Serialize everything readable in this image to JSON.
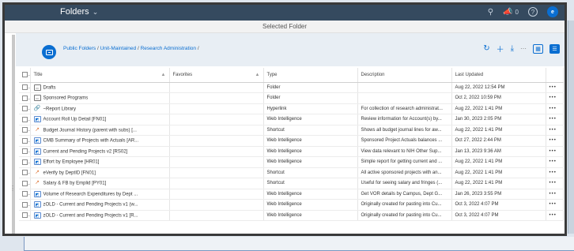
{
  "header": {
    "app_title": "Folders",
    "title_chevron": "chevron-down-icon",
    "notification_count": "0",
    "avatar_initial": "e"
  },
  "subbar": {
    "title": "Selected Folder"
  },
  "breadcrumb": {
    "parts": [
      "Public Folders",
      "Unit-Maintained",
      "Research Administration"
    ],
    "separator": " / "
  },
  "table": {
    "columns": [
      "Title",
      "Favorites",
      "Type",
      "Description",
      "Last Updated"
    ],
    "rows": [
      {
        "icon": "folder-icon",
        "title": "Drafts",
        "favorites": "",
        "type": "Folder",
        "description": "",
        "updated": "Aug 22, 2022 12:54 PM"
      },
      {
        "icon": "folder-icon",
        "title": "Sponsored Programs",
        "favorites": "",
        "type": "Folder",
        "description": "",
        "updated": "Oct 2, 2022 10:59 PM"
      },
      {
        "icon": "hyperlink-icon",
        "title": "~Report Library",
        "favorites": "",
        "type": "Hyperlink",
        "description": "For collection of research administrat...",
        "updated": "Aug 22, 2022 1:41 PM"
      },
      {
        "icon": "web-intelligence-icon",
        "title": "Account Roll Up Detail [FN01]",
        "favorites": "",
        "type": "Web Intelligence",
        "description": "Review information for Account(s) by...",
        "updated": "Jan 30, 2023 2:05 PM"
      },
      {
        "icon": "shortcut-icon",
        "title": "Budget Journal History (parent with subs) [...",
        "favorites": "",
        "type": "Shortcut",
        "description": "Shows all budget journal lines for aw...",
        "updated": "Aug 22, 2022 1:41 PM"
      },
      {
        "icon": "web-intelligence-icon",
        "title": "CMB Summary of Projects with Actuals [AR...",
        "favorites": "",
        "type": "Web Intelligence",
        "description": "Sponsored Project Actuals balances ...",
        "updated": "Oct 27, 2022 2:44 PM"
      },
      {
        "icon": "web-intelligence-icon",
        "title": "Current and Pending Projects v2 [RS02]",
        "favorites": "",
        "type": "Web Intelligence",
        "description": "View data relevant to NIH Other Sup...",
        "updated": "Jan 13, 2023 9:36 AM"
      },
      {
        "icon": "web-intelligence-icon",
        "title": "Effort by Employee [HR01]",
        "favorites": "",
        "type": "Web Intelligence",
        "description": "Simple report for getting current and ...",
        "updated": "Aug 22, 2022 1:41 PM"
      },
      {
        "icon": "shortcut-icon",
        "title": "eVerify by DeptID [FN01]",
        "favorites": "",
        "type": "Shortcut",
        "description": "All active sponsored projects with an...",
        "updated": "Aug 22, 2022 1:41 PM"
      },
      {
        "icon": "shortcut-icon",
        "title": "Salary & FB by Emplid [PY01]",
        "favorites": "",
        "type": "Shortcut",
        "description": "Useful for seeing salary and fringes (...",
        "updated": "Aug 22, 2022 1:41 PM"
      },
      {
        "icon": "web-intelligence-icon",
        "title": "Volume of Research Expenditures by Dept ...",
        "favorites": "",
        "type": "Web Intelligence",
        "description": "Get VOR details by Campus, Dept G...",
        "updated": "Jan 26, 2023 3:55 PM"
      },
      {
        "icon": "web-intelligence-icon",
        "title": "zOLD - Current and Pending Projects v1 (w...",
        "favorites": "",
        "type": "Web Intelligence",
        "description": "Originally created for pasting into Cu...",
        "updated": "Oct 3, 2022 4:07 PM"
      },
      {
        "icon": "web-intelligence-icon",
        "title": "zOLD - Current and Pending Projects v1 [R...",
        "favorites": "",
        "type": "Web Intelligence",
        "description": "Originally created for pasting into Cu...",
        "updated": "Oct 3, 2022 4:07 PM"
      }
    ]
  },
  "colors": {
    "shell": "#354a5f",
    "accent": "#0a6ed1",
    "crumb_bg": "#e8eef4"
  }
}
